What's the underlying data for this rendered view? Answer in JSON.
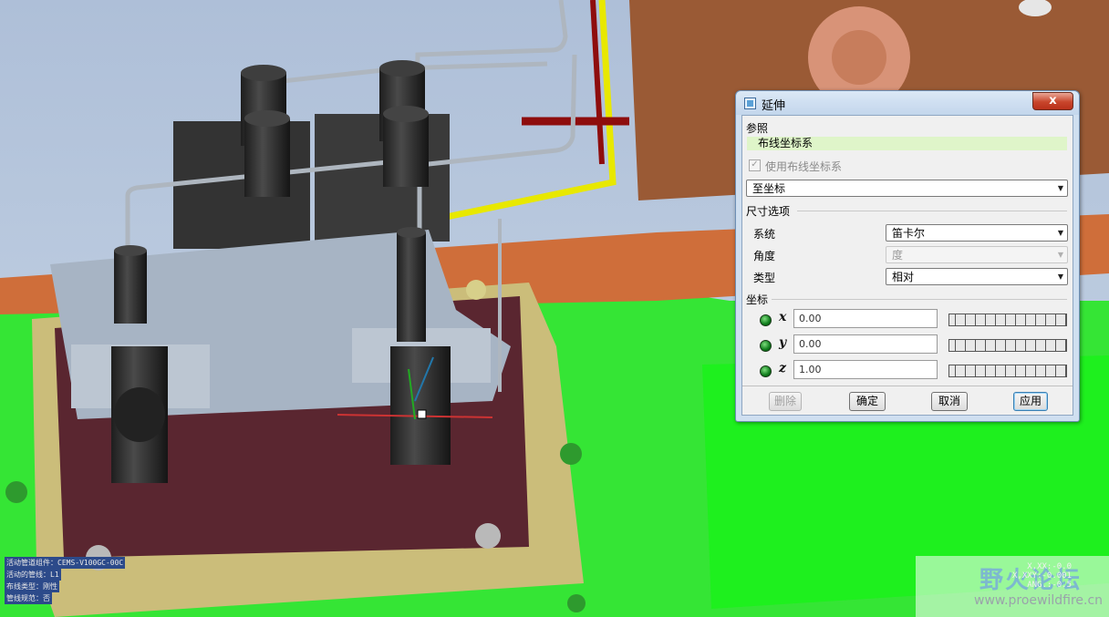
{
  "dialog": {
    "title": "延伸",
    "close_label": "x",
    "ref_heading": "参照",
    "ref_value": "布线坐标系",
    "use_routing_csys_label": "使用布线坐标系",
    "mode_value": "至坐标",
    "dims_heading": "尺寸选项",
    "system_label": "系统",
    "system_value": "笛卡尔",
    "angle_label": "角度",
    "angle_value": "度",
    "type_label": "类型",
    "type_value": "相对",
    "coords_heading": "坐标",
    "x_label": "x",
    "x_value": "0.00",
    "y_label": "y",
    "y_value": "0.00",
    "z_label": "z",
    "z_value": "1.00",
    "buttons": {
      "delete": "删除",
      "ok": "确定",
      "cancel": "取消",
      "apply": "应用"
    }
  },
  "status": {
    "line1": "活动管道组件：CEMS-V100GC-00C",
    "line2": "活动的管线：L1",
    "line3": "布线类型：刚性",
    "line4": "管线规范：否"
  },
  "coords_readout": {
    "line1": "X,XX:-0.0",
    "line2": "X,XXY:-0.001",
    "line3": "ANG.:-0.5"
  },
  "watermark": {
    "text": "野火论坛",
    "url": "www.proewildfire.cn"
  }
}
